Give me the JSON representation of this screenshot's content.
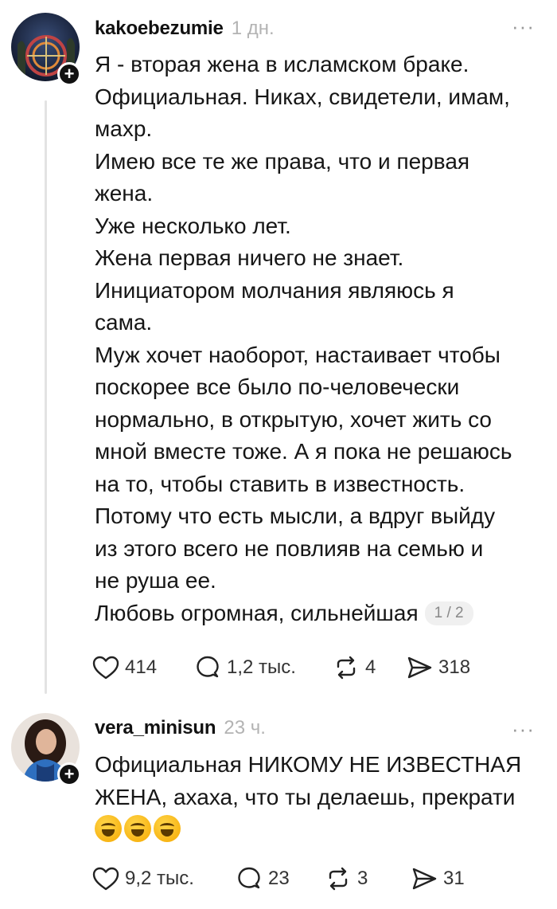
{
  "posts": [
    {
      "username": "kakoebezumie",
      "time": "1 дн.",
      "more": "···",
      "lines": [
        "Я - вторая жена в исламском браке.",
        "Официальная. Никах, свидетели, имам,",
        "махр.",
        "Имею все те же права, что и первая",
        "жена.",
        "Уже несколько лет.",
        "Жена первая ничего не знает.",
        "Инициатором молчания являюсь я",
        "сама.",
        "Муж хочет наоборот, настаивает чтобы",
        "поскорее все было по-человечески",
        "нормально, в открытую, хочет жить со",
        "мной вместе тоже. А я пока не решаюсь",
        "на то, чтобы ставить в известность.",
        "Потому что есть мысли, а вдруг выйду",
        "из этого всего не повлияв на семью и",
        "не руша ее.",
        "Любовь огромная, сильнейшая"
      ],
      "page_badge": "1 / 2",
      "likes": "414",
      "replies": "1,2 тыс.",
      "reposts": "4",
      "shares": "318"
    },
    {
      "username": "vera_minisun",
      "time": "23 ч.",
      "more": "···",
      "lines": [
        "Официальная НИКОМУ НЕ ИЗВЕСТНАЯ",
        "ЖЕНА, ахаха, что ты делаешь, прекрати"
      ],
      "emojis": [
        "rolling-on-floor-laughing",
        "rolling-on-floor-laughing",
        "rolling-on-floor-laughing"
      ],
      "likes": "9,2 тыс.",
      "replies": "23",
      "reposts": "3",
      "shares": "31"
    }
  ]
}
